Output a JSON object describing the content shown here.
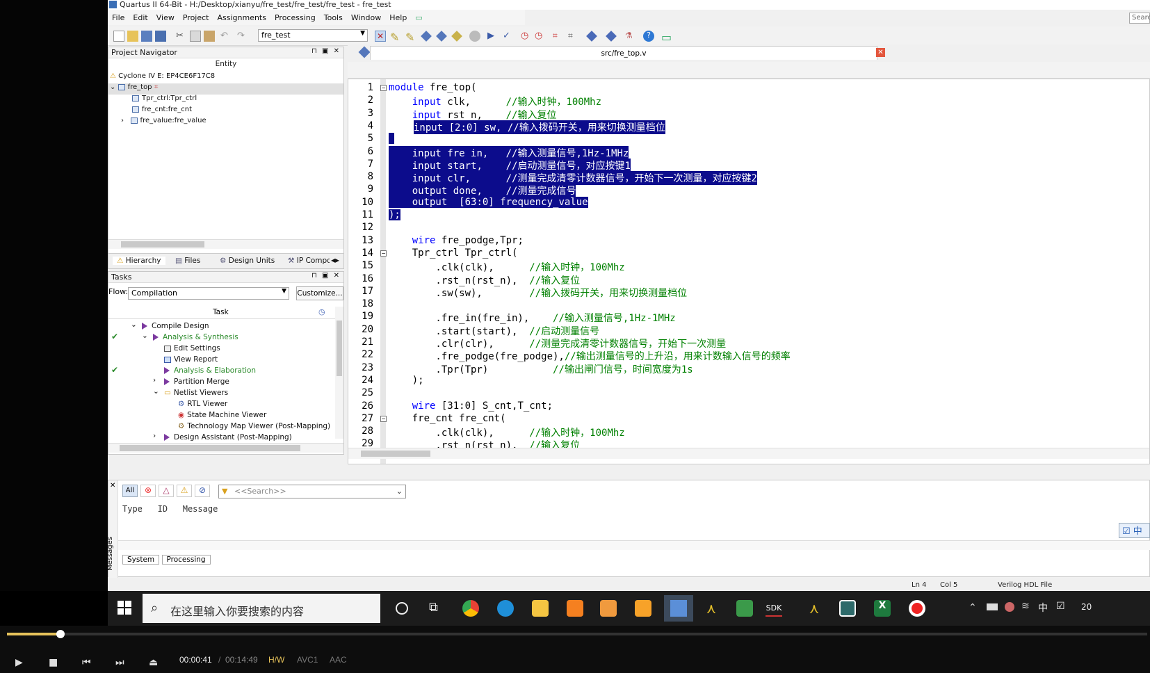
{
  "window": {
    "title": "Quartus II 64-Bit - H:/Desktop/xianyu/fre_test/fre_test/fre_test - fre_test",
    "search": "Searc"
  },
  "menu": [
    "File",
    "Edit",
    "View",
    "Project",
    "Assignments",
    "Processing",
    "Tools",
    "Window",
    "Help"
  ],
  "toolbar": {
    "project_combo": "fre_test"
  },
  "navigator": {
    "title": "Project Navigator",
    "header": "Entity",
    "device": "Cyclone IV E: EP4CE6F17C8",
    "top": "fre_top",
    "children": [
      "Tpr_ctrl:Tpr_ctrl",
      "fre_cnt:fre_cnt",
      "fre_value:fre_value"
    ],
    "tabs": [
      "Hierarchy",
      "Files",
      "Design Units",
      "IP Compo"
    ]
  },
  "tasks": {
    "title": "Tasks",
    "flow_label": "Flow:",
    "flow_value": "Compilation",
    "customize": "Customize...",
    "column": "Task",
    "rows": [
      {
        "label": "Compile Design",
        "done": false
      },
      {
        "label": "Analysis & Synthesis",
        "done": true
      },
      {
        "label": "Edit Settings",
        "done": false
      },
      {
        "label": "View Report",
        "done": false
      },
      {
        "label": "Analysis & Elaboration",
        "done": true
      },
      {
        "label": "Partition Merge",
        "done": false
      },
      {
        "label": "Netlist Viewers",
        "done": false
      },
      {
        "label": "RTL Viewer",
        "done": false
      },
      {
        "label": "State Machine Viewer",
        "done": false
      },
      {
        "label": "Technology Map Viewer (Post-Mapping)",
        "done": false
      },
      {
        "label": "Design Assistant (Post-Mapping)",
        "done": false
      }
    ]
  },
  "editor": {
    "tab": "src/fre_top.v",
    "lines": [
      {
        "n": "1",
        "t": "module fre_top("
      },
      {
        "n": "2",
        "t": "    input clk,      //输入时钟，100Mhz"
      },
      {
        "n": "3",
        "t": "    input rst_n,    //输入复位"
      },
      {
        "n": "4",
        "t": "    input [2:0] sw, //输入拨码开关，用来切换测量档位"
      },
      {
        "n": "5",
        "t": ""
      },
      {
        "n": "6",
        "t": "    input fre_in,   //输入测量信号,1Hz-1MHz"
      },
      {
        "n": "7",
        "t": "    input start,    //启动测量信号，对应按键1"
      },
      {
        "n": "8",
        "t": "    input clr,      //测量完成清零计数器信号，开始下一次测量，对应按键2"
      },
      {
        "n": "9",
        "t": "    output done,    //测量完成信号"
      },
      {
        "n": "10",
        "t": "    output  [63:0] frequency_value"
      },
      {
        "n": "11",
        "t": ");"
      },
      {
        "n": "12",
        "t": ""
      },
      {
        "n": "13",
        "t": "    wire fre_podge,Tpr;"
      },
      {
        "n": "14",
        "t": "    Tpr_ctrl Tpr_ctrl("
      },
      {
        "n": "15",
        "t": "        .clk(clk),      //输入时钟，100Mhz"
      },
      {
        "n": "16",
        "t": "        .rst_n(rst_n),  //输入复位"
      },
      {
        "n": "17",
        "t": "        .sw(sw),        //输入拨码开关，用来切换测量档位"
      },
      {
        "n": "18",
        "t": ""
      },
      {
        "n": "19",
        "t": "        .fre_in(fre_in),    //输入测量信号,1Hz-1MHz"
      },
      {
        "n": "20",
        "t": "        .start(start),  //启动测量信号"
      },
      {
        "n": "21",
        "t": "        .clr(clr),      //测量完成清零计数器信号，开始下一次测量"
      },
      {
        "n": "22",
        "t": "        .fre_podge(fre_podge),//输出测量信号的上升沿，用来计数输入信号的频率"
      },
      {
        "n": "23",
        "t": "        .Tpr(Tpr)           //输出闸门信号，时间宽度为1s"
      },
      {
        "n": "24",
        "t": "    );"
      },
      {
        "n": "25",
        "t": ""
      },
      {
        "n": "26",
        "t": "    wire [31:0] S_cnt,T_cnt;"
      },
      {
        "n": "27",
        "t": "    fre_cnt fre_cnt("
      },
      {
        "n": "28",
        "t": "        .clk(clk),      //输入时钟，100Mhz"
      },
      {
        "n": "29",
        "t": "        .rst_n(rst_n),  //输入复位"
      }
    ]
  },
  "messages": {
    "filter_all": "All",
    "search_placeholder": "<<Search>>",
    "columns": [
      "Type",
      "ID",
      "Message"
    ],
    "side_label": "Messages",
    "tabs": [
      "System",
      "Processing"
    ]
  },
  "status": {
    "ln": "Ln 4",
    "col": "Col 5",
    "filetype": "Verilog HDL File"
  },
  "taskbar": {
    "search": "在这里输入你要搜索的内容",
    "ime": "中",
    "sdk": "SDK",
    "clock": "20"
  },
  "ime_badge": "中",
  "player": {
    "current": "00:00:41",
    "sep": "/",
    "total": "00:14:49",
    "hw": "H/W",
    "vcodec": "AVC1",
    "acodec": "AAC",
    "progress": 0.047
  }
}
